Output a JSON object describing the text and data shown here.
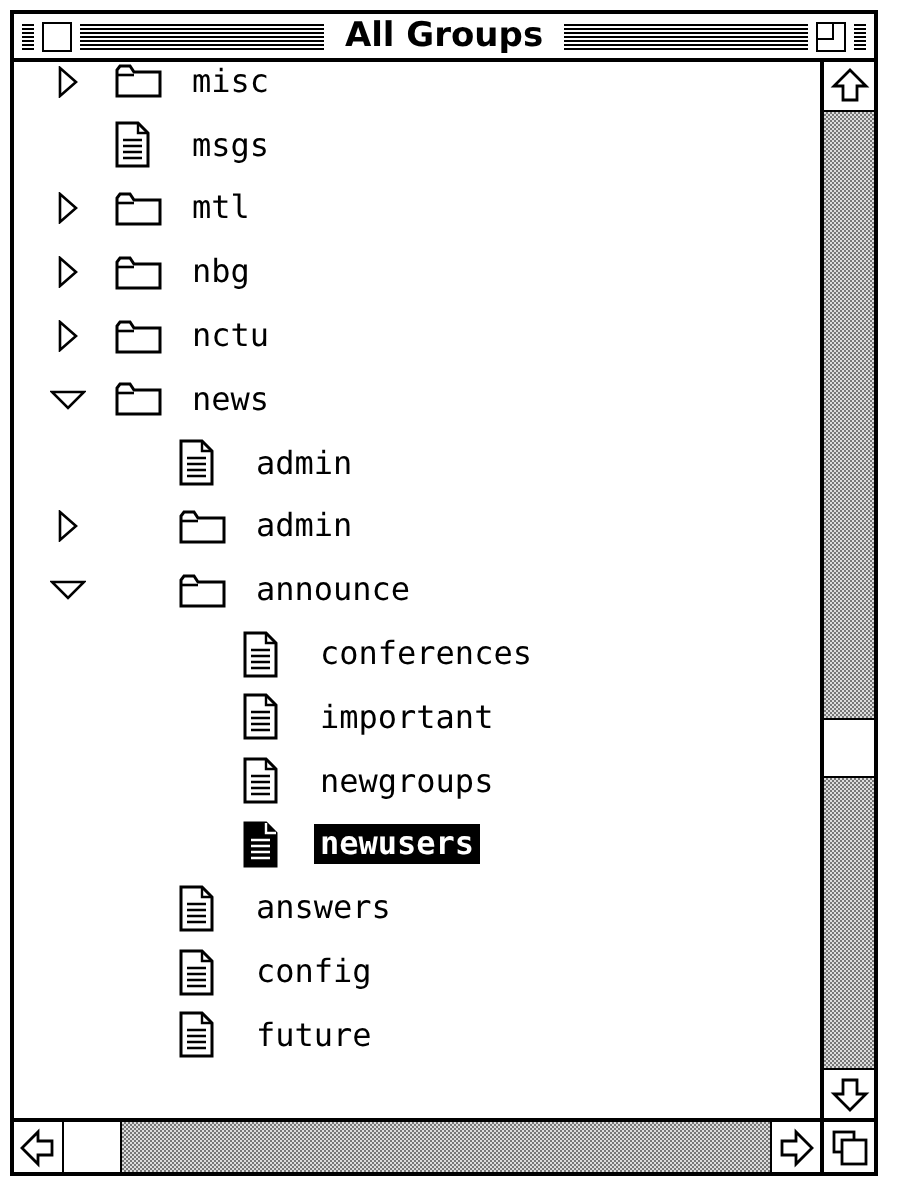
{
  "window": {
    "title": "All Groups"
  },
  "tree": [
    {
      "label": "misc",
      "kind": "folder",
      "expanded": false,
      "selected": false
    },
    {
      "label": "msgs",
      "kind": "document",
      "selected": false
    },
    {
      "label": "mtl",
      "kind": "folder",
      "expanded": false,
      "selected": false
    },
    {
      "label": "nbg",
      "kind": "folder",
      "expanded": false,
      "selected": false
    },
    {
      "label": "nctu",
      "kind": "folder",
      "expanded": false,
      "selected": false
    },
    {
      "label": "news",
      "kind": "folder",
      "expanded": true,
      "selected": false,
      "children": [
        {
          "label": "admin",
          "kind": "document",
          "selected": false
        },
        {
          "label": "admin",
          "kind": "folder",
          "expanded": false,
          "selected": false
        },
        {
          "label": "announce",
          "kind": "folder",
          "expanded": true,
          "selected": false,
          "children": [
            {
              "label": "conferences",
              "kind": "document",
              "selected": false
            },
            {
              "label": "important",
              "kind": "document",
              "selected": false
            },
            {
              "label": "newgroups",
              "kind": "document",
              "selected": false
            },
            {
              "label": "newusers",
              "kind": "document",
              "selected": true
            }
          ]
        },
        {
          "label": "answers",
          "kind": "document",
          "selected": false
        },
        {
          "label": "config",
          "kind": "document",
          "selected": false
        },
        {
          "label": "future",
          "kind": "document",
          "selected": false
        }
      ]
    }
  ]
}
